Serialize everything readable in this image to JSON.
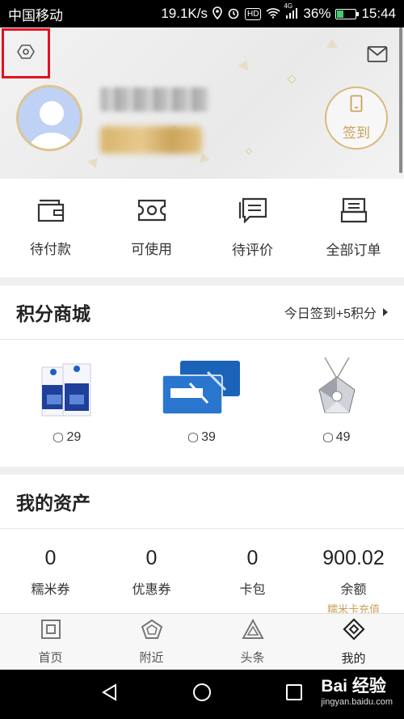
{
  "status_bar": {
    "carrier": "中国移动",
    "speed": "19.1K/s",
    "hd": "HD",
    "network": "4G",
    "battery": "36%",
    "battery_level": 0.36,
    "time": "15:44"
  },
  "header": {
    "settings_icon": "settings-icon",
    "message_icon": "mail-icon",
    "checkin_label": "签到"
  },
  "orders": {
    "items": [
      {
        "label": "待付款",
        "icon": "wallet-icon"
      },
      {
        "label": "可使用",
        "icon": "ticket-icon"
      },
      {
        "label": "待评价",
        "icon": "comment-icon"
      },
      {
        "label": "全部订单",
        "icon": "orders-icon"
      }
    ]
  },
  "points_mall": {
    "title": "积分商城",
    "more": "今日签到+5积分",
    "goods": [
      {
        "points": "29"
      },
      {
        "points": "39"
      },
      {
        "points": "49"
      }
    ]
  },
  "assets": {
    "title": "我的资产",
    "items": [
      {
        "value": "0",
        "label": "糯米券",
        "sub": ""
      },
      {
        "value": "0",
        "label": "优惠券",
        "sub": ""
      },
      {
        "value": "0",
        "label": "卡包",
        "sub": ""
      },
      {
        "value": "900.02",
        "label": "余额",
        "sub": "糯米卡充值"
      }
    ]
  },
  "tabbar": {
    "tabs": [
      {
        "label": "首页",
        "icon": "home-icon"
      },
      {
        "label": "附近",
        "icon": "nearby-icon"
      },
      {
        "label": "头条",
        "icon": "headline-icon"
      },
      {
        "label": "我的",
        "icon": "mine-icon"
      }
    ]
  },
  "watermark": {
    "brand": "Bai 经验",
    "url": "jingyan.baidu.com"
  },
  "colors": {
    "accent_gold": "#c9a25a",
    "highlight_red": "#e3101e"
  }
}
